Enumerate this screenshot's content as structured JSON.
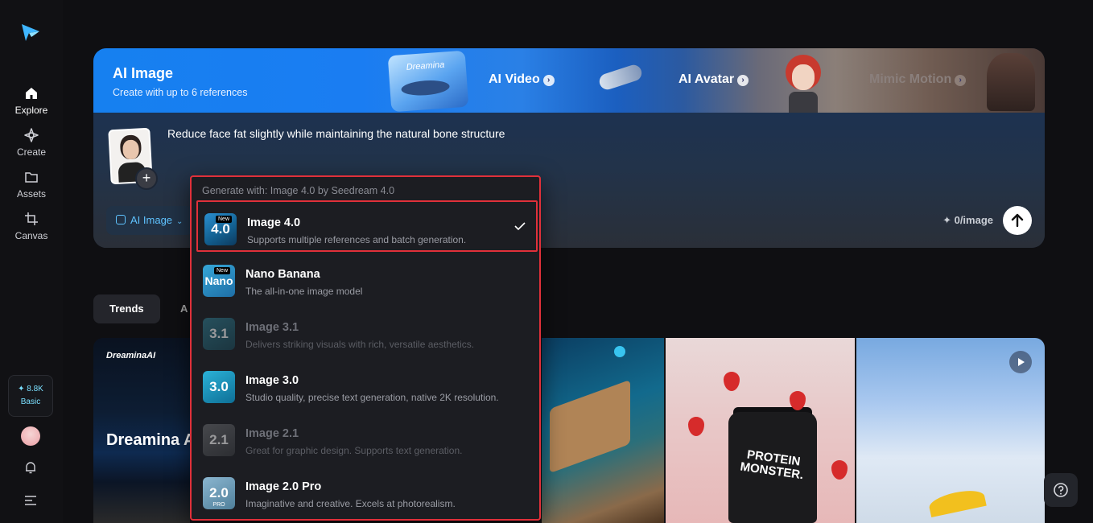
{
  "sidebar": {
    "items": [
      {
        "label": "Explore",
        "icon": "home-icon"
      },
      {
        "label": "Create",
        "icon": "sparkle-icon"
      },
      {
        "label": "Assets",
        "icon": "folder-icon"
      },
      {
        "label": "Canvas",
        "icon": "crop-icon"
      }
    ],
    "credits": {
      "amount": "✦ 8.8K",
      "plan": "Basic"
    }
  },
  "hero": {
    "title": "AI Image",
    "subtitle": "Create with up to 6 references",
    "tiles": [
      {
        "label": "AI Video"
      },
      {
        "label": "AI Avatar"
      },
      {
        "label": "Mimic Motion"
      }
    ],
    "tile_brand": "Dreamina"
  },
  "composer": {
    "prompt": "Reduce face fat slightly while maintaining the natural bone structure",
    "mode_label": "AI Image",
    "add_symbol": "+",
    "cost": "✦ 0/image"
  },
  "tabs": {
    "active": "Trends",
    "partial": "A"
  },
  "gallery": {
    "brand": "DreaminaAI",
    "headline": "Dreamina A",
    "product_text": "PROTEIN MONSTER."
  },
  "dropdown": {
    "header": "Generate with: Image 4.0 by Seedream 4.0",
    "items": [
      {
        "name": "Image 4.0",
        "desc": "Supports multiple references and batch generation.",
        "thumb": "4.0",
        "badge": "New",
        "selected": true
      },
      {
        "name": "Nano Banana",
        "desc": "The all-in-one image model",
        "thumb": "Nano",
        "badge": "New"
      },
      {
        "name": "Image 3.1",
        "desc": "Delivers striking visuals with rich, versatile aesthetics.",
        "thumb": "3.1",
        "dim": true
      },
      {
        "name": "Image 3.0",
        "desc": "Studio quality, precise text generation, native 2K resolution.",
        "thumb": "3.0"
      },
      {
        "name": "Image 2.1",
        "desc": "Great for graphic design. Supports text generation.",
        "thumb": "2.1",
        "dim": true
      },
      {
        "name": "Image 2.0 Pro",
        "desc": "Imaginative and creative. Excels at photorealism.",
        "thumb": "2.0",
        "sub": "PRO"
      }
    ]
  },
  "colors": {
    "accent": "#1a7df2",
    "highlight": "#e0303a",
    "mode_text": "#5fc3ff"
  }
}
